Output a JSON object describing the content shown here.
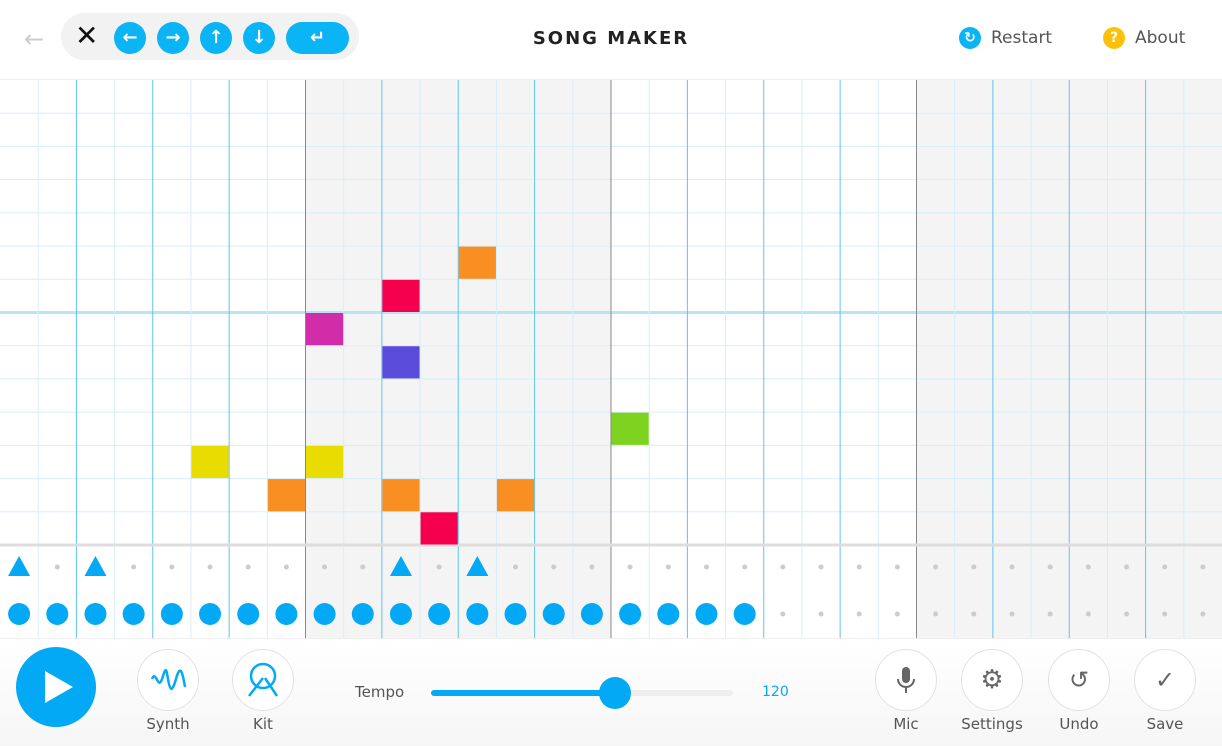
{
  "header": {
    "title": "SONG MAKER",
    "restart_label": "Restart",
    "about_label": "About",
    "back_icon": "arrow-left-icon",
    "keyboard_buttons": [
      {
        "name": "left",
        "glyph": "←"
      },
      {
        "name": "right",
        "glyph": "→"
      },
      {
        "name": "up",
        "glyph": "↑"
      },
      {
        "name": "down",
        "glyph": "↓"
      }
    ],
    "close_glyph": "✕",
    "enter_glyph": "↵",
    "restart_glyph": "↻",
    "about_glyph": "?"
  },
  "colors": {
    "accent": "#03a9f4",
    "restart": "#0bb4f5",
    "about": "#fcc10b",
    "shade": "#f4f4f4"
  },
  "grid": {
    "steps": 32,
    "rows": 14,
    "shaded_bars": [
      1,
      3
    ],
    "octave_line_after_row": 6,
    "notes": [
      {
        "step": 12,
        "row": 5,
        "color": "#f98e23"
      },
      {
        "step": 10,
        "row": 6,
        "color": "#f5004c"
      },
      {
        "step": 8,
        "row": 7,
        "color": "#d22da8"
      },
      {
        "step": 10,
        "row": 8,
        "color": "#5b4bdb"
      },
      {
        "step": 16,
        "row": 10,
        "color": "#7ed321"
      },
      {
        "step": 5,
        "row": 11,
        "color": "#e8dc00"
      },
      {
        "step": 8,
        "row": 11,
        "color": "#e8dc00"
      },
      {
        "step": 7,
        "row": 12,
        "color": "#f98e23"
      },
      {
        "step": 10,
        "row": 12,
        "color": "#f98e23"
      },
      {
        "step": 13,
        "row": 12,
        "color": "#f98e23"
      },
      {
        "step": 11,
        "row": 13,
        "color": "#f5004c"
      }
    ]
  },
  "percussion": {
    "triangle_steps": [
      0,
      2,
      10,
      12
    ],
    "circle_steps": [
      0,
      1,
      2,
      3,
      4,
      5,
      6,
      7,
      8,
      9,
      10,
      11,
      12,
      13,
      14,
      15,
      16,
      17,
      18,
      19
    ]
  },
  "toolbar": {
    "synth_label": "Synth",
    "kit_label": "Kit",
    "tempo_label": "Tempo",
    "tempo_value": "120",
    "tempo_fraction": 0.61,
    "mic_label": "Mic",
    "settings_label": "Settings",
    "undo_label": "Undo",
    "save_label": "Save"
  }
}
